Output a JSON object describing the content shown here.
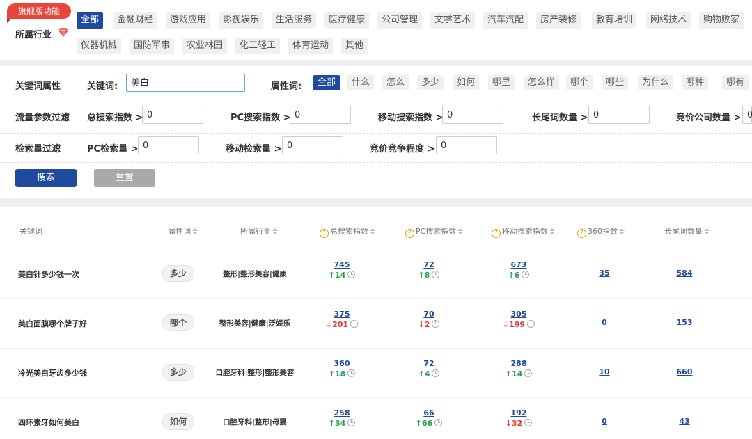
{
  "badge": "旗舰版功能",
  "industry": {
    "label": "所属行业",
    "tags": [
      "全部",
      "金融财经",
      "游戏应用",
      "影视娱乐",
      "生活服务",
      "医疗健康",
      "公司管理",
      "文学艺术",
      "汽车汽配",
      "房产装修",
      "教育培训",
      "网络技术",
      "购物败家",
      "仪器机械",
      "国防军事",
      "农业林园",
      "化工轻工",
      "体育运动",
      "其他"
    ]
  },
  "filters": {
    "kw_attr_label": "关键词属性",
    "keyword_label": "关键词:",
    "keyword_value": "美白",
    "prop_label": "属性词:",
    "prop_tags": [
      "全部",
      "什么",
      "怎么",
      "多少",
      "如何",
      "哪里",
      "怎么样",
      "哪个",
      "哪些",
      "为什么",
      "哪种",
      "哪有"
    ],
    "traffic_label": "流量参数过滤",
    "total_label": "总搜索指数 >",
    "total_value": "0",
    "pc_label": "PC搜索指数 >",
    "pc_value": "0",
    "mobile_label": "移动搜索指数 >",
    "mobile_value": "0",
    "longtail_label": "长尾词数量 >",
    "longtail_value": "0",
    "bid_label": "竞价公司数量 >",
    "bid_value": "0",
    "volume_label": "检索量过滤",
    "pcvol_label": "PC检索量 >",
    "pcvol_value": "0",
    "mobvol_label": "移动检索量 >",
    "mobvol_value": "0",
    "compete_label": "竞价竞争程度 >",
    "compete_value": "0",
    "search_btn": "搜索",
    "reset_btn": "重置"
  },
  "table": {
    "headers": {
      "keyword": "关键词",
      "attr": "属性词",
      "industry": "所属行业",
      "total": "总搜索指数",
      "pc": "PC搜索指数",
      "mobile": "移动搜索指数",
      "s360": "360指数",
      "longtail": "长尾词数量"
    },
    "rows": [
      {
        "keyword": "美白针多少钱一次",
        "attr": "多少",
        "industry": "整形|整形美容|健康",
        "total": "745",
        "total_delta": "14",
        "total_dir": "up",
        "pc": "72",
        "pc_delta": "8",
        "pc_dir": "up",
        "mobile": "673",
        "mobile_delta": "6",
        "mobile_dir": "up",
        "s360": "35",
        "longtail": "584"
      },
      {
        "keyword": "美白面膜哪个牌子好",
        "attr": "哪个",
        "industry": "整形美容|健康|泛娱乐",
        "total": "375",
        "total_delta": "201",
        "total_dir": "down",
        "pc": "70",
        "pc_delta": "2",
        "pc_dir": "down",
        "mobile": "305",
        "mobile_delta": "199",
        "mobile_dir": "down",
        "s360": "0",
        "longtail": "153"
      },
      {
        "keyword": "冷光美白牙齿多少钱",
        "attr": "多少",
        "industry": "口腔牙科|整形|整形美容",
        "total": "360",
        "total_delta": "18",
        "total_dir": "up",
        "pc": "72",
        "pc_delta": "4",
        "pc_dir": "up",
        "mobile": "288",
        "mobile_delta": "14",
        "mobile_dir": "up",
        "s360": "10",
        "longtail": "660"
      },
      {
        "keyword": "四环素牙如何美白",
        "attr": "如何",
        "industry": "口腔牙科|整形|母婴",
        "total": "258",
        "total_delta": "34",
        "total_dir": "up",
        "pc": "66",
        "pc_delta": "66",
        "pc_dir": "up",
        "mobile": "192",
        "mobile_delta": "32",
        "mobile_dir": "down",
        "s360": "0",
        "longtail": "43"
      }
    ]
  },
  "colors": {
    "primary": "#1f4aa0",
    "badge": "#e8453c",
    "up": "#2a9d4a",
    "down": "#e53935",
    "reset": "#a9a9a9"
  }
}
